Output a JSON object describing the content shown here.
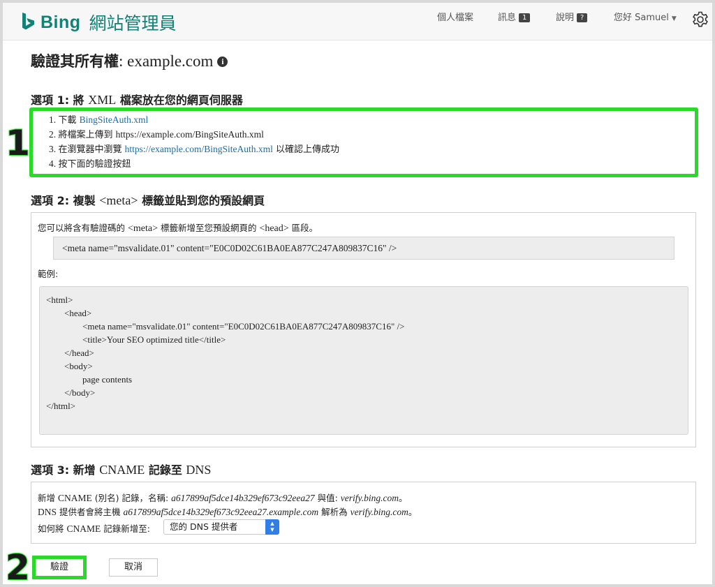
{
  "header": {
    "logo_brand": "Bing",
    "logo_product": "網站管理員",
    "nav": {
      "profile": "個人檔案",
      "messages": "訊息",
      "messages_count": "1",
      "help": "說明",
      "help_badge": "?",
      "greeting": "您好 Samuel"
    }
  },
  "page": {
    "title_zh": "驗證其所有權",
    "title_domain": ": example.com"
  },
  "option1": {
    "heading_prefix": "選項 1: 將 ",
    "heading_xml": "XML",
    "heading_suffix": " 檔案放在您的網頁伺服器",
    "steps": [
      {
        "num": "1.",
        "text": "下載 ",
        "link": "BingSiteAuth.xml",
        "tail": ""
      },
      {
        "num": "2.",
        "text": "將檔案上傳到 ",
        "link": "",
        "tail": "https://example.com/BingSiteAuth.xml"
      },
      {
        "num": "3.",
        "text": "在瀏覽器中瀏覽 ",
        "link": "https://example.com/BingSiteAuth.xml",
        "tail": " 以確認上傳成功"
      },
      {
        "num": "4.",
        "text": "按下面的驗證按鈕",
        "link": "",
        "tail": ""
      }
    ]
  },
  "option2": {
    "heading_prefix": "選項 2: 複製 ",
    "heading_meta": "<meta>",
    "heading_suffix": " 標籤並貼到您的預設網頁",
    "intro_a": "您可以將含有驗證碼的 ",
    "intro_meta": "<meta>",
    "intro_b": " 標籤新增至您預設網頁的 ",
    "intro_head": "<head>",
    "intro_c": " 區段。",
    "meta_tag": "<meta name=\"msvalidate.01\" content=\"E0C0D02C61BA0EA877C247A809837C16\" />",
    "example_label": "範例:",
    "code": [
      "<html>",
      "<head>",
      "<meta name=\"msvalidate.01\" content=\"E0C0D02C61BA0EA877C247A809837C16\" />",
      "<title>Your SEO optimized title</title>",
      "</head>",
      "<body>",
      "page contents",
      "</body>",
      "</html>"
    ]
  },
  "option3": {
    "heading_prefix": "選項 3: 新增 ",
    "heading_cname": "CNAME",
    "heading_mid": " 記錄至 ",
    "heading_dns": "DNS",
    "line1_a": "新增 ",
    "line1_cname": "CNAME",
    "line1_b": " (別名) 記錄，名稱: ",
    "line1_name": "a617899af5dce14b329ef673c92eea27",
    "line1_c": " 與值: ",
    "line1_value": "verify.bing.com",
    "line1_d": "。",
    "line2_a": "DNS",
    "line2_b": " 提供者會將主機 ",
    "line2_host": "a617899af5dce14b329ef673c92eea27.example.com",
    "line2_c": " 解析為 ",
    "line2_value": "verify.bing.com",
    "line2_d": "。",
    "line3_a": "如何將 ",
    "line3_cname": "CNAME",
    "line3_b": " 記錄新增至:",
    "select_value": "您的 DNS 提供者"
  },
  "buttons": {
    "verify": "驗證",
    "cancel": "取消"
  },
  "callouts": {
    "one": "1",
    "two": "2"
  },
  "colors": {
    "brand": "#128276",
    "link": "#1a6ca8",
    "highlight": "#2bd92b",
    "select_accent": "#2f7fe6"
  }
}
